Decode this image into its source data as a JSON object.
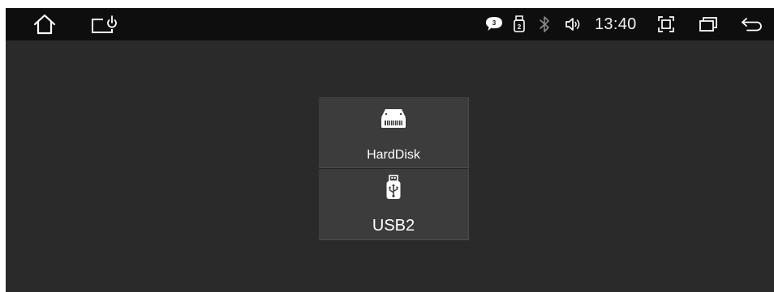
{
  "status_bar": {
    "left_icons": [
      {
        "icon": "home-icon"
      },
      {
        "icon": "screen-power-icon"
      }
    ],
    "notification_badge": {
      "icon": "chat-bubble-icon",
      "count": "3"
    },
    "usb_storage_indicator": {
      "icon": "usb-storage-icon",
      "count": "2"
    },
    "bluetooth": {
      "icon": "bluetooth-icon"
    },
    "volume": {
      "icon": "volume-icon"
    },
    "time": "13:40",
    "right_icons": [
      {
        "icon": "screenshot-icon"
      },
      {
        "icon": "recent-apps-icon"
      },
      {
        "icon": "back-icon"
      }
    ]
  },
  "storage_list": {
    "items": [
      {
        "icon": "harddisk-icon",
        "label": "HardDisk"
      },
      {
        "icon": "usb-drive-icon",
        "label": "USB2"
      }
    ]
  },
  "colors": {
    "status_bar_bg": "#0e0e0e",
    "screen_bg": "#2a2a2a",
    "tile_bg": "#3c3c3c",
    "text": "#ffffff"
  }
}
